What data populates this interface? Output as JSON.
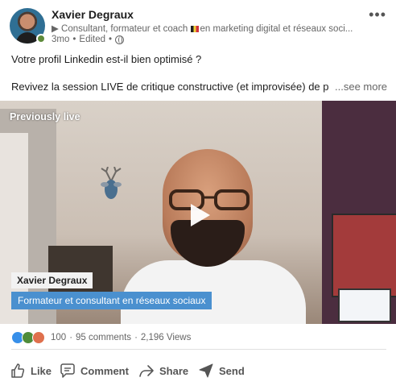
{
  "post": {
    "author": "Xavier Degraux",
    "headline": "▶ Consultant, formateur et coach",
    "headline_rest": "en marketing digital et réseaux soci...",
    "age": "3mo",
    "edited": "Edited",
    "menu": "•••",
    "line1": "Votre profil Linkedin est-il bien optimisé ?",
    "line2": "Revivez la session LIVE de critique constructive (et improvisée) de p",
    "see_more": "...see more"
  },
  "video": {
    "status_label": "Previously live",
    "lower_third_name": "Xavier Degraux",
    "lower_third_title": "Formateur et consultant en réseaux sociaux"
  },
  "social": {
    "reactions_count": "100",
    "comments": "95 comments",
    "views": "2,196 Views",
    "reaction_types": [
      "like-icon",
      "support-icon",
      "love-icon"
    ]
  },
  "actions": {
    "like": "Like",
    "comment": "Comment",
    "share": "Share",
    "send": "Send"
  },
  "colors": {
    "presence": "#5e8a3a",
    "lower_third": "#4a90cf",
    "like_reaction": "#378fe9"
  }
}
